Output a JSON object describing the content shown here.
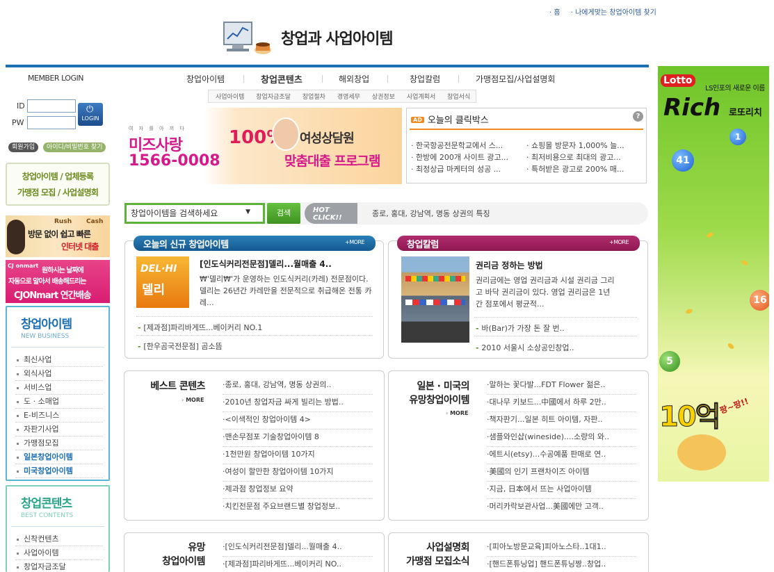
{
  "top_links": [
    "홈",
    "나에게맞는 창업아이템 찾기"
  ],
  "site_title": "창업과 사업아이템",
  "nav": [
    "창업아이템",
    "창업콘텐츠",
    "해외창업",
    "창업칼럼",
    "가맹점모집/사업설명회"
  ],
  "subnav": [
    "사업아이템",
    "창업자금조달",
    "창업절차",
    "경영세무",
    "상권정보",
    "사업계획서",
    "창업서식"
  ],
  "login": {
    "title": "MEMBER LOGIN",
    "id_label": "ID",
    "pw_label": "PW",
    "button": "LOGIN",
    "join": "회원가입",
    "find": "아이디/비밀번호 찾기"
  },
  "register": [
    "창업아이템 / 업체등록",
    "가맹점 모집 / 사업설명회"
  ],
  "side_ads": {
    "ad1_line1": "Rush",
    "ad1_line2": "Cash",
    "ad1_text": "방문 없이 쉽고 빠른",
    "ad1_text2": "인터넷 대출",
    "ad2_logo": "CJ onmart",
    "ad2_line1": "원하시는 날짜에",
    "ad2_line2": "자동으로 알아서 배송해드리는",
    "ad2_line3": "CJONmart 연간배송"
  },
  "cat1": {
    "title": "창업아이템",
    "sub": "NEW BUSINESS",
    "items": [
      "최신사업",
      "외식사업",
      "서비스업",
      "도 · 소매업",
      "E-비즈니스",
      "자판기사업",
      "가맹점모집",
      "일본창업아이템",
      "미국창업아이템"
    ]
  },
  "cat2": {
    "title": "창업콘텐츠",
    "sub": "BEST CONTENTS",
    "items": [
      "신착컨텐츠",
      "사업아이템",
      "창업자금조달"
    ]
  },
  "banner": {
    "small": "여 자 를 아 끼 다",
    "brand": "미즈사랑",
    "phone": "1566-0008",
    "pct": "100%",
    "counsel": "여성상담원",
    "program": "맞춤대출 프로그램"
  },
  "clickbox": {
    "badge": "AD",
    "title": "오늘의 클릭박스",
    "help": "?",
    "items": [
      "한국항공전문학교에서 스...",
      "쇼핑몰 방문자 1,000% 늘...",
      "한방에 200개 사이트 광고...",
      "최저비용으로 최대의 광고...",
      "최정상급 마케터의 성공 ...",
      "특허받은 광고로 200% 매..."
    ]
  },
  "search": {
    "placeholder": "창업아이템을 검색하세요",
    "button": "검색",
    "hot1": "HOT",
    "hot2": "CLICK!!",
    "keyword": "종로, 홍대, 강남역, 명동 상권의 특징"
  },
  "new_items": {
    "title": "오늘의 신규 창업아이템",
    "more": "+MORE",
    "logo_text": "DEL·HI",
    "logo_text2": "델리",
    "headline": "[인도식커리전문점]델리...월매출 4..",
    "body": "₩'델리₩'가 운영하는 인도식커리(카레) 전문점이다. 델리는 26년간 카레만을 전문적으로 취급해온 전통 카레...",
    "list": [
      "[제과점]파리바게뜨...베이커리 NO.1",
      "[한우곰국전문점] 곰소뜸"
    ]
  },
  "column": {
    "title": "창업칼럼",
    "more": "+MORE",
    "headline": "권리금 정하는 방법",
    "body": "권리금에는 영업 권리금과 시설 권리금 그리고 바닥 권리금이 있다. 영업 권리금은 1년간 점포에서 평균적...",
    "list": [
      "바(Bar)가 가장 돈 잘 번..",
      "2010 서울시 소상공인창업.."
    ]
  },
  "best": {
    "title": "베스트 콘텐츠",
    "more": "MORE",
    "items": [
      "종로, 홍대, 강남역, 명동 상권의..",
      "2010년 창업자금 싸게 빌리는 방법..",
      "<이색적인 창업아이템 4>",
      "맨손무점포 기술창업아이템 8",
      "1천만원 창업아이템 10가지",
      "여성이 할만한 창업아이템 10가지",
      "제과점 창업정보 요약",
      "치킨전문점 주요브랜드별 창업정보.."
    ]
  },
  "japan": {
    "title1": "일본 · 미국의",
    "title2": "유망창업아이템",
    "more": "MORE",
    "items": [
      "말하는 꽃다발...FDT Flower 젊은..",
      "대나무 키보드...中國에서 하루 2만..",
      "책자판기...일본 히트 아이템, 자판..",
      "샘플와인샵(wineside)....소량의 와..",
      "에트시(etsy)...수공예품 판매로 연..",
      "美國의 인기 프랜차이즈 아이템",
      "지금, 日本에서 뜨는 사업아이템",
      "머리카락보관사업...美國에만 고객.."
    ]
  },
  "promising": {
    "title1": "유망",
    "title2": "창업아이템",
    "items": [
      "[인도식커리전문점]델리...월매출 4..",
      "[제과점]파리바게뜨...베이커리 NO.."
    ]
  },
  "bizinfo": {
    "title1": "사업설명회",
    "title2": "가맹점 모집소식",
    "items": [
      "[피아노방문교육]피아노스타..1대1..",
      "[핸드폰튜닝업] 핸드폰튜닝짱..창업.."
    ]
  },
  "lotto": {
    "badge": "Lotto",
    "sub": "LS인포의 새로운 이름",
    "rich": "Rich",
    "brand": "로또리치",
    "balls": [
      "41",
      "1",
      "16",
      "5"
    ],
    "amount": "10억",
    "wow": "팡~팡!!"
  },
  "colors": {
    "brand_blue": "#1d6fb4",
    "green": "#5db33a",
    "magenta": "#d6188b",
    "orange": "#f08a1f"
  }
}
